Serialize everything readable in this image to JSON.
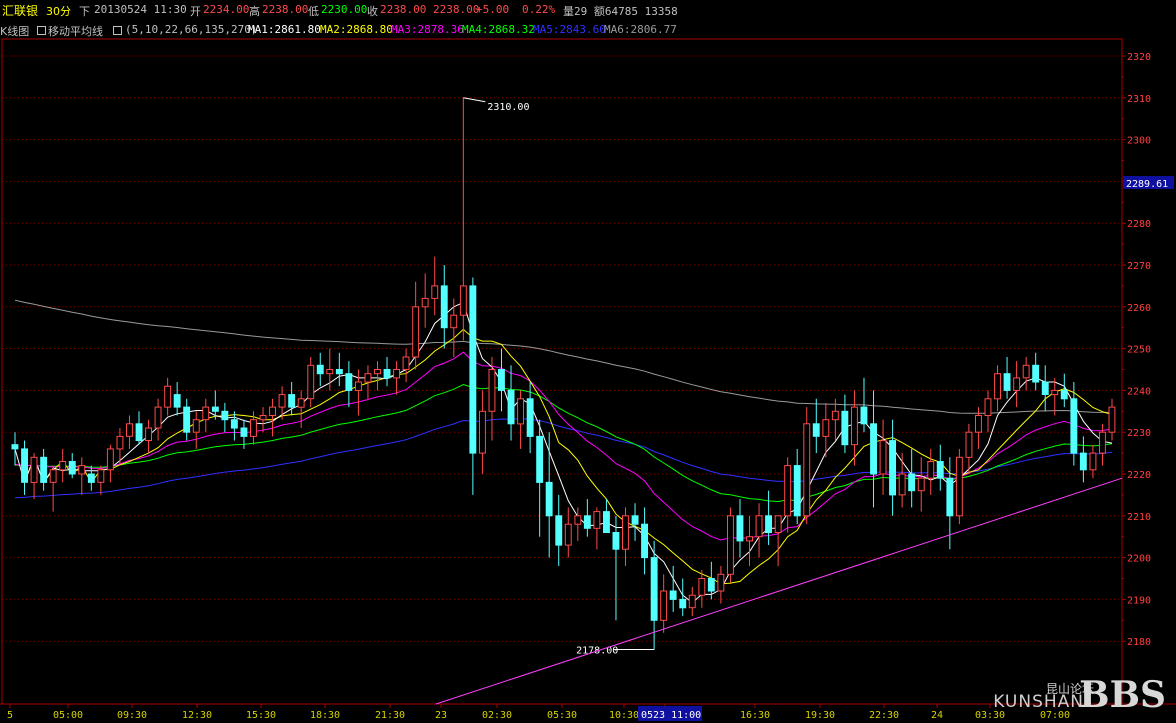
{
  "header": {
    "symbol": "汇联银",
    "period": "30分",
    "direction": "下",
    "datetime": "20130524 11:30",
    "open_label": "开",
    "open": "2234.00",
    "high_label": "高",
    "high": "2238.00",
    "low_label": "低",
    "low": "2230.00",
    "close_label": "收",
    "close": "2238.00 2238.00",
    "change": "+5.00",
    "pct": "0.22%",
    "vol": "量29 额64785 13358"
  },
  "ma_bar": {
    "kline_label": "K线图",
    "ma_label": "移动平均线",
    "params": "(5,10,22,66,135,270)",
    "ma1": "MA1:2861.80",
    "ma2": "MA2:2868.80",
    "ma3": "MA3:2878.36",
    "ma4": "MA4:2868.32",
    "ma5": "MA5:2843.60",
    "ma6": "MA6:2806.77"
  },
  "colors": {
    "up": "#ff4a4a",
    "down": "#54ffff",
    "ma1": "#ffffff",
    "ma2": "#ffff00",
    "ma3": "#ff00ff",
    "ma4": "#00ff00",
    "ma5": "#3030ff",
    "ma6": "#9a9a9a",
    "grid": "#7a0000",
    "trend": "#ff40ff"
  },
  "chart_data": {
    "type": "candlestick",
    "ylim": [
      2170,
      2325
    ],
    "yticks": [
      "2320",
      "2310",
      "2300",
      "2290",
      "2280",
      "2270",
      "2260",
      "2250",
      "2240",
      "2230",
      "2220",
      "2210",
      "2200",
      "2190",
      "2180"
    ],
    "current_price_label": "2289.61",
    "xticks": [
      "5",
      "05:00",
      "09:30",
      "12:30",
      "15:30",
      "18:30",
      "21:30",
      "23",
      "02:30",
      "05:30",
      "10:30",
      "0523 11:00",
      "16:30",
      "19:30",
      "22:30",
      "24",
      "03:30",
      "07:00"
    ],
    "annotations": [
      {
        "text": "2310.00",
        "value": 2310
      },
      {
        "text": "2178.00",
        "value": 2178
      }
    ],
    "candles": [
      [
        2227,
        2230,
        2222,
        2226
      ],
      [
        2226,
        2228,
        2215,
        2218
      ],
      [
        2218,
        2225,
        2214,
        2224
      ],
      [
        2224,
        2226,
        2216,
        2218
      ],
      [
        2218,
        2222,
        2211,
        2221
      ],
      [
        2221,
        2226,
        2218,
        2223
      ],
      [
        2223,
        2225,
        2219,
        2220
      ],
      [
        2220,
        2224,
        2215,
        2222
      ],
      [
        2220,
        2222,
        2216,
        2218
      ],
      [
        2218,
        2222,
        2215,
        2221
      ],
      [
        2221,
        2227,
        2218,
        2226
      ],
      [
        2226,
        2231,
        2222,
        2229
      ],
      [
        2229,
        2234,
        2226,
        2232
      ],
      [
        2232,
        2235,
        2227,
        2228
      ],
      [
        2228,
        2233,
        2225,
        2231
      ],
      [
        2231,
        2238,
        2228,
        2236
      ],
      [
        2236,
        2243,
        2234,
        2241
      ],
      [
        2239,
        2242,
        2234,
        2236
      ],
      [
        2236,
        2238,
        2228,
        2230
      ],
      [
        2230,
        2235,
        2226,
        2233
      ],
      [
        2233,
        2238,
        2230,
        2236
      ],
      [
        2236,
        2240,
        2233,
        2235
      ],
      [
        2235,
        2237,
        2230,
        2233
      ],
      [
        2233,
        2235,
        2228,
        2231
      ],
      [
        2231,
        2233,
        2226,
        2229
      ],
      [
        2229,
        2235,
        2227,
        2233
      ],
      [
        2233,
        2236,
        2230,
        2234
      ],
      [
        2234,
        2238,
        2229,
        2236
      ],
      [
        2236,
        2241,
        2233,
        2239
      ],
      [
        2239,
        2242,
        2234,
        2236
      ],
      [
        2236,
        2240,
        2231,
        2238
      ],
      [
        2238,
        2248,
        2236,
        2246
      ],
      [
        2246,
        2249,
        2241,
        2244
      ],
      [
        2244,
        2250,
        2240,
        2245
      ],
      [
        2245,
        2249,
        2241,
        2244
      ],
      [
        2244,
        2247,
        2236,
        2240
      ],
      [
        2240,
        2245,
        2234,
        2242
      ],
      [
        2242,
        2246,
        2238,
        2244
      ],
      [
        2244,
        2247,
        2240,
        2245
      ],
      [
        2245,
        2248,
        2241,
        2243
      ],
      [
        2243,
        2247,
        2239,
        2245
      ],
      [
        2245,
        2250,
        2242,
        2248
      ],
      [
        2248,
        2266,
        2245,
        2260
      ],
      [
        2260,
        2268,
        2255,
        2262
      ],
      [
        2262,
        2272,
        2258,
        2265
      ],
      [
        2265,
        2270,
        2250,
        2255
      ],
      [
        2255,
        2262,
        2248,
        2258
      ],
      [
        2258,
        2310,
        2252,
        2265
      ],
      [
        2265,
        2267,
        2215,
        2225
      ],
      [
        2225,
        2240,
        2220,
        2235
      ],
      [
        2235,
        2248,
        2228,
        2245
      ],
      [
        2245,
        2250,
        2235,
        2240
      ],
      [
        2240,
        2246,
        2228,
        2232
      ],
      [
        2232,
        2240,
        2226,
        2238
      ],
      [
        2238,
        2242,
        2225,
        2229
      ],
      [
        2229,
        2233,
        2205,
        2218
      ],
      [
        2218,
        2230,
        2200,
        2210
      ],
      [
        2210,
        2215,
        2198,
        2203
      ],
      [
        2203,
        2212,
        2200,
        2208
      ],
      [
        2208,
        2212,
        2204,
        2210
      ],
      [
        2210,
        2214,
        2205,
        2207
      ],
      [
        2207,
        2212,
        2202,
        2211
      ],
      [
        2211,
        2214,
        2207,
        2206
      ],
      [
        2206,
        2210,
        2185,
        2202
      ],
      [
        2202,
        2212,
        2198,
        2210
      ],
      [
        2210,
        2213,
        2204,
        2208
      ],
      [
        2208,
        2212,
        2196,
        2200
      ],
      [
        2200,
        2204,
        2178,
        2185
      ],
      [
        2185,
        2196,
        2182,
        2192
      ],
      [
        2192,
        2198,
        2187,
        2190
      ],
      [
        2190,
        2195,
        2186,
        2188
      ],
      [
        2188,
        2193,
        2186,
        2191
      ],
      [
        2191,
        2197,
        2188,
        2195
      ],
      [
        2195,
        2199,
        2190,
        2192
      ],
      [
        2192,
        2198,
        2189,
        2196
      ],
      [
        2196,
        2212,
        2194,
        2210
      ],
      [
        2210,
        2214,
        2200,
        2204
      ],
      [
        2204,
        2210,
        2198,
        2205
      ],
      [
        2205,
        2213,
        2200,
        2210
      ],
      [
        2210,
        2216,
        2203,
        2206
      ],
      [
        2206,
        2210,
        2198,
        2210
      ],
      [
        2210,
        2224,
        2206,
        2222
      ],
      [
        2222,
        2226,
        2208,
        2210
      ],
      [
        2210,
        2236,
        2208,
        2232
      ],
      [
        2232,
        2238,
        2225,
        2229
      ],
      [
        2229,
        2237,
        2224,
        2233
      ],
      [
        2233,
        2238,
        2228,
        2235
      ],
      [
        2235,
        2239,
        2225,
        2227
      ],
      [
        2227,
        2240,
        2222,
        2236
      ],
      [
        2236,
        2243,
        2230,
        2232
      ],
      [
        2232,
        2240,
        2212,
        2220
      ],
      [
        2220,
        2233,
        2215,
        2228
      ],
      [
        2228,
        2233,
        2210,
        2215
      ],
      [
        2215,
        2225,
        2212,
        2220
      ],
      [
        2220,
        2226,
        2212,
        2216
      ],
      [
        2216,
        2224,
        2211,
        2219
      ],
      [
        2219,
        2226,
        2215,
        2223
      ],
      [
        2223,
        2227,
        2216,
        2219
      ],
      [
        2219,
        2224,
        2202,
        2210
      ],
      [
        2210,
        2226,
        2208,
        2224
      ],
      [
        2224,
        2232,
        2220,
        2230
      ],
      [
        2230,
        2236,
        2226,
        2234
      ],
      [
        2234,
        2240,
        2230,
        2238
      ],
      [
        2238,
        2246,
        2235,
        2244
      ],
      [
        2244,
        2248,
        2238,
        2240
      ],
      [
        2240,
        2247,
        2236,
        2243
      ],
      [
        2243,
        2248,
        2240,
        2246
      ],
      [
        2246,
        2249,
        2240,
        2242
      ],
      [
        2242,
        2246,
        2235,
        2239
      ],
      [
        2239,
        2243,
        2234,
        2240
      ],
      [
        2240,
        2244,
        2236,
        2238
      ],
      [
        2238,
        2242,
        2222,
        2225
      ],
      [
        2225,
        2229,
        2218,
        2221
      ],
      [
        2221,
        2227,
        2219,
        2225
      ],
      [
        2225,
        2232,
        2222,
        2230
      ],
      [
        2230,
        2238,
        2228,
        2236
      ]
    ]
  },
  "watermark": {
    "cn": "昆山论坛",
    "en": "KUNSHAN",
    "bbs": "BBS"
  }
}
